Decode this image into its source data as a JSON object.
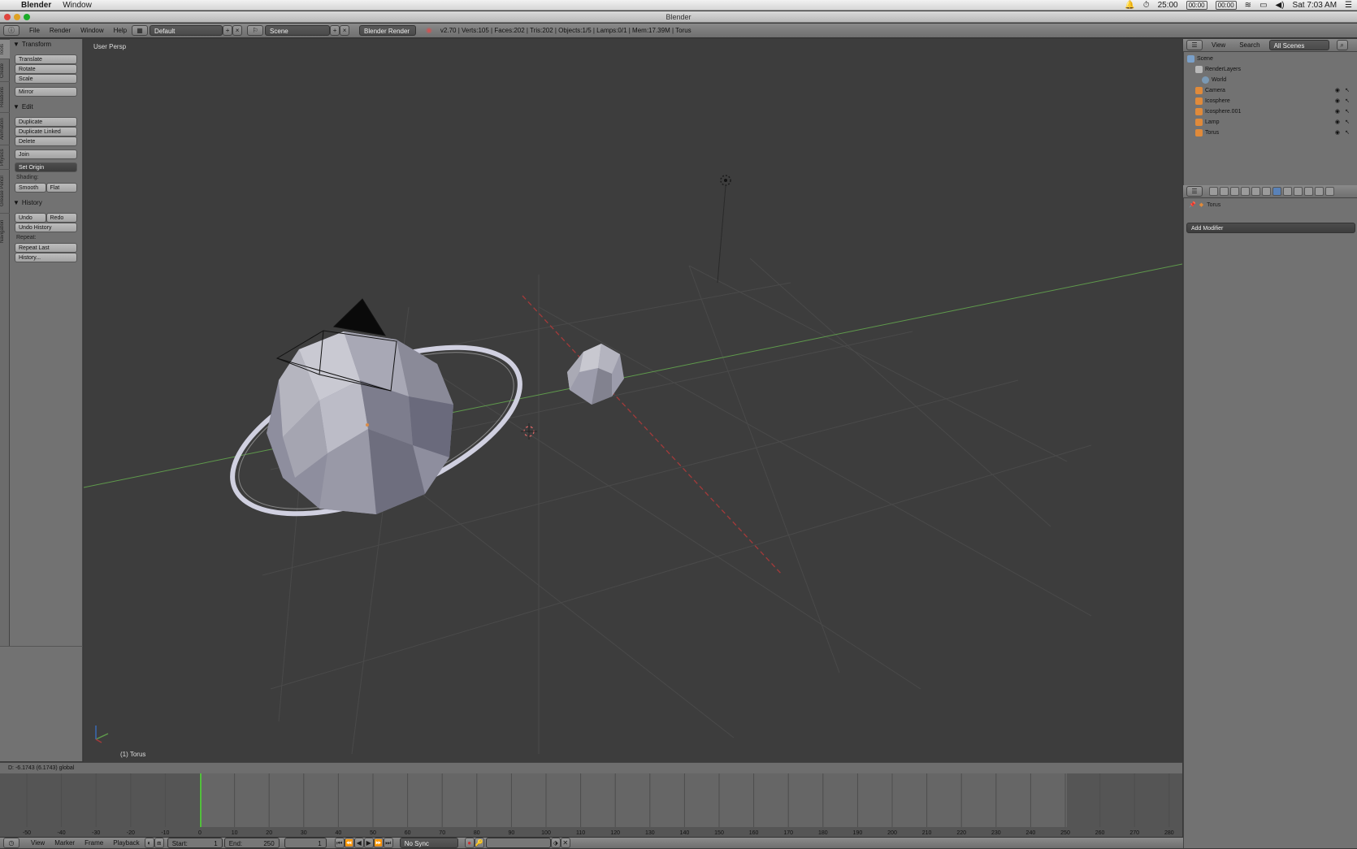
{
  "menubar": {
    "app_name": "Blender",
    "window_menu": "Window",
    "clock": "25:00",
    "timer1": "00:00",
    "timer2": "00:00",
    "datetime": "Sat 7:03 AM"
  },
  "window": {
    "title": "Blender"
  },
  "header": {
    "menus": [
      "File",
      "Render",
      "Window",
      "Help"
    ],
    "layout": "Default",
    "scene": "Scene",
    "engine": "Blender Render",
    "stats": "v2.70 | Verts:105 | Faces:202 | Tris:202 | Objects:1/5 | Lamps:0/1 | Mem:17.39M | Torus"
  },
  "tool_tabs": [
    "Tools",
    "Create",
    "Relations",
    "Animation",
    "Physics",
    "Grease Pencil",
    "Navigation"
  ],
  "tools": {
    "transform_header": "Transform",
    "translate": "Translate",
    "rotate": "Rotate",
    "scale": "Scale",
    "mirror": "Mirror",
    "edit_header": "Edit",
    "duplicate": "Duplicate",
    "duplicate_linked": "Duplicate Linked",
    "delete": "Delete",
    "join": "Join",
    "set_origin": "Set Origin",
    "shading_label": "Shading:",
    "smooth": "Smooth",
    "flat": "Flat",
    "history_header": "History",
    "undo": "Undo",
    "redo": "Redo",
    "undo_history": "Undo History",
    "repeat_label": "Repeat:",
    "repeat_last": "Repeat Last",
    "history": "History..."
  },
  "viewport": {
    "view_label": "User Persp",
    "object_label": "(1) Torus"
  },
  "status": {
    "text": "D: -6.1743 (6.1743) global"
  },
  "timeline": {
    "ticks": [
      "-50",
      "-40",
      "-30",
      "-20",
      "-10",
      "0",
      "10",
      "20",
      "30",
      "40",
      "50",
      "60",
      "70",
      "80",
      "90",
      "100",
      "110",
      "120",
      "130",
      "140",
      "150",
      "160",
      "170",
      "180",
      "190",
      "200",
      "210",
      "220",
      "230",
      "240",
      "250",
      "260",
      "270",
      "280"
    ],
    "current_frame": 0,
    "menus": [
      "View",
      "Marker",
      "Frame",
      "Playback"
    ],
    "start_label": "Start:",
    "start_value": "1",
    "end_label": "End:",
    "end_value": "250",
    "frame_value": "1",
    "sync": "No Sync"
  },
  "outliner": {
    "view": "View",
    "search": "Search",
    "scenes": "All Scenes",
    "items": [
      {
        "name": "Scene",
        "color": "#7aa0c9"
      },
      {
        "name": "RenderLayers",
        "color": "#b9b9b9"
      },
      {
        "name": "World",
        "color": "#7a99b4"
      },
      {
        "name": "Camera",
        "color": "#e08a3a"
      },
      {
        "name": "Icosphere",
        "color": "#e08a3a"
      },
      {
        "name": "Icosphere.001",
        "color": "#e08a3a"
      },
      {
        "name": "Lamp",
        "color": "#e08a3a"
      },
      {
        "name": "Torus",
        "color": "#e08a3a"
      }
    ]
  },
  "properties": {
    "object_name": "Torus",
    "add_modifier": "Add Modifier"
  },
  "colors": {
    "viewport_bg": "#3d3d3d",
    "x_axis": "#a33a3a",
    "y_axis": "#5f9a4c",
    "selection": "#e08a3a"
  }
}
